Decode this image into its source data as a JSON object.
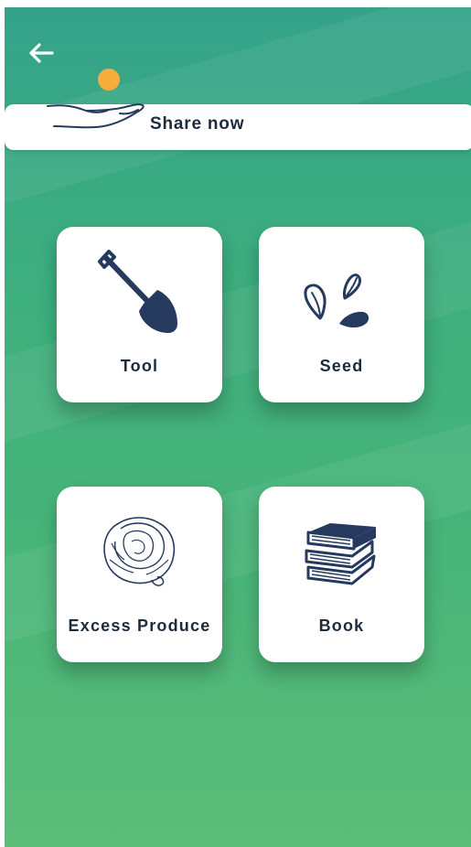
{
  "header": {
    "back_icon": "arrow-left-icon",
    "share_label": "Share now",
    "share_icon": "hand-with-sun-icon",
    "sun_color": "#f6ad3c"
  },
  "categories": [
    {
      "label": "Tool",
      "icon": "shovel-icon"
    },
    {
      "label": "Seed",
      "icon": "seeds-icon"
    },
    {
      "label": "Excess Produce",
      "icon": "cabbage-icon"
    },
    {
      "label": "Book",
      "icon": "books-icon"
    }
  ],
  "colors": {
    "background_top": "#34a389",
    "background_bottom": "#5bbd78",
    "text": "#1e2b3d",
    "icon": "#253a5e"
  }
}
